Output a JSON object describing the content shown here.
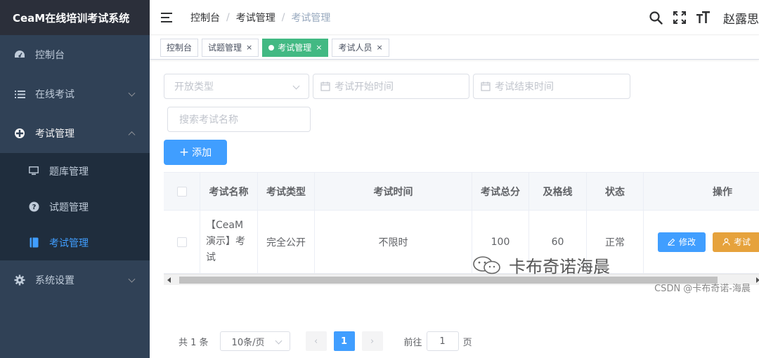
{
  "app": {
    "title": "CeaM在线培训考试系统"
  },
  "sidebar": {
    "items": [
      {
        "label": "控制台",
        "icon": "dashboard-icon"
      },
      {
        "label": "在线考试",
        "icon": "list-icon"
      },
      {
        "label": "考试管理",
        "icon": "nested-icon"
      },
      {
        "label": "系统设置",
        "icon": "gear-icon"
      }
    ],
    "subitems": [
      {
        "label": "题库管理",
        "icon": "monitor-icon"
      },
      {
        "label": "试题管理",
        "icon": "question-icon"
      },
      {
        "label": "考试管理",
        "icon": "book-icon"
      }
    ]
  },
  "header": {
    "breadcrumb": [
      "控制台",
      "考试管理",
      "考试管理"
    ],
    "username": "赵露思"
  },
  "tags": [
    {
      "label": "控制台",
      "closable": false
    },
    {
      "label": "试题管理",
      "closable": true
    },
    {
      "label": "考试管理",
      "closable": true,
      "active": true
    },
    {
      "label": "考试人员",
      "closable": true
    }
  ],
  "tag_close_glyph": "×",
  "filters": {
    "open_type_placeholder": "开放类型",
    "start_time_placeholder": "考试开始时间",
    "end_time_placeholder": "考试结束时间",
    "search_placeholder": "搜索考试名称"
  },
  "actions": {
    "add_label": "添加",
    "add_glyph": "+"
  },
  "table": {
    "columns": [
      "考试名称",
      "考试类型",
      "考试时间",
      "考试总分",
      "及格线",
      "状态",
      "操作"
    ],
    "rows": [
      {
        "name": "【CeaM演示】考试",
        "type": "完全公开",
        "time": "不限时",
        "total": "100",
        "pass": "60",
        "status": "正常",
        "edit_label": "修改",
        "exam_label": "考试"
      }
    ]
  },
  "pagination": {
    "total_text": "共 1 条",
    "page_size": "10条/页",
    "current_page": "1",
    "goto_label": "前往",
    "goto_value": "1",
    "page_unit": "页",
    "prev_glyph": "‹",
    "next_glyph": "›"
  },
  "watermark": {
    "main": "卡布奇诺海晨",
    "sub": "CSDN @卡布奇诺-海晨"
  },
  "colors": {
    "sidebar_bg": "#304156",
    "primary": "#409eff",
    "tag_active": "#42b983",
    "warning": "#e6a23c"
  }
}
